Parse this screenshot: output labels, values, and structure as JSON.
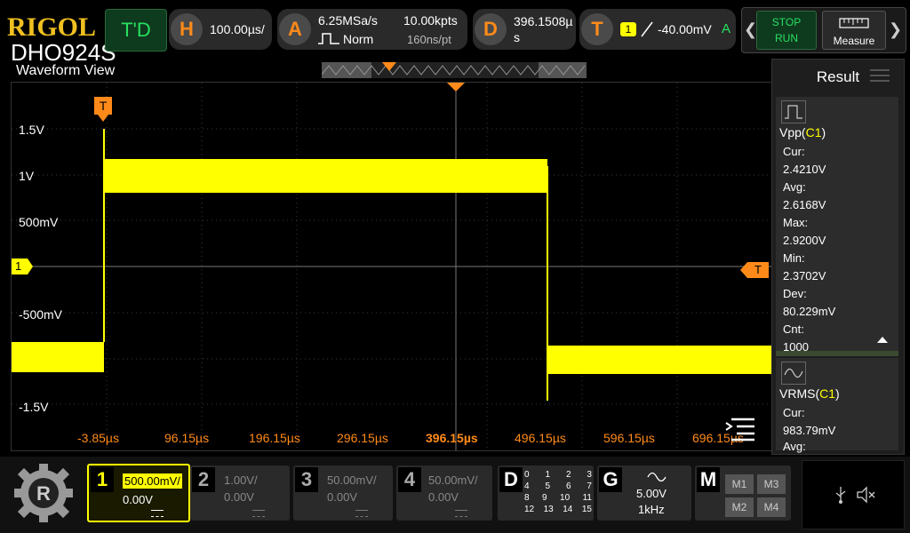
{
  "brand": {
    "logo": "RIGOL",
    "model": "DHO924S"
  },
  "view_title": "Waveform View",
  "trigger_mode": "T'D",
  "horizontal": {
    "letter": "H",
    "scale": "100.00µs/"
  },
  "acquire": {
    "letter": "A",
    "rate": "6.25MSa/s",
    "mode": "Norm",
    "points": "10.00kpts",
    "time_per_point": "160ns/pt"
  },
  "delay": {
    "letter": "D",
    "value_line1": "396.1508µ",
    "value_line2": "s"
  },
  "trigger": {
    "letter": "T",
    "source": "1",
    "level": "-40.00mV",
    "auto": "A"
  },
  "run_control": {
    "stop": "STOP",
    "run": "RUN"
  },
  "measure_label": "Measure",
  "scope": {
    "trigger_marker": "T",
    "channel_marker": "1",
    "level_marker": "T",
    "y_labels": [
      "1.5V",
      "1V",
      "500mV",
      "-500mV",
      "-1.5V"
    ],
    "x_ticks": [
      "-3.85µs",
      "96.15µs",
      "196.15µs",
      "296.15µs",
      "396.15µs",
      "496.15µs",
      "596.15µs",
      "696.15µs"
    ]
  },
  "result_panel": {
    "title": "Result",
    "vpp": {
      "name": "Vpp",
      "ch": "C1",
      "cur_label": "Cur:",
      "cur": "2.4210V",
      "avg_label": "Avg:",
      "avg": "2.6168V",
      "max_label": "Max:",
      "max": "2.9200V",
      "min_label": "Min:",
      "min": "2.3702V",
      "dev_label": "Dev:",
      "dev": "80.229mV",
      "cnt_label": "Cnt:",
      "cnt": "1000"
    },
    "vrms": {
      "name": "VRMS",
      "ch": "C1",
      "cur_label": "Cur:",
      "cur": "983.79mV",
      "avg_label": "Avg:"
    }
  },
  "channels": [
    {
      "num": "1",
      "scale": "500.00mV/",
      "offset": "0.00V",
      "active": true
    },
    {
      "num": "2",
      "scale": "1.00V/",
      "offset": "0.00V",
      "active": false
    },
    {
      "num": "3",
      "scale": "50.00mV/",
      "offset": "0.00V",
      "active": false
    },
    {
      "num": "4",
      "scale": "50.00mV/",
      "offset": "0.00V",
      "active": false
    }
  ],
  "digital": {
    "letter": "D",
    "rows": [
      [
        "0",
        "1",
        "2",
        "3"
      ],
      [
        "4",
        "5",
        "6",
        "7"
      ],
      [
        "8",
        "9",
        "10",
        "11"
      ],
      [
        "12",
        "13",
        "14",
        "15"
      ]
    ]
  },
  "generator": {
    "letter": "G",
    "amplitude": "5.00V",
    "freq": "1kHz"
  },
  "math": {
    "letter": "M",
    "items": [
      "M1",
      "M3",
      "M2",
      "M4"
    ]
  },
  "colors": {
    "ch1": "#ffff00",
    "accent": "#ff8a1a",
    "trigger_green": "#28e060"
  }
}
